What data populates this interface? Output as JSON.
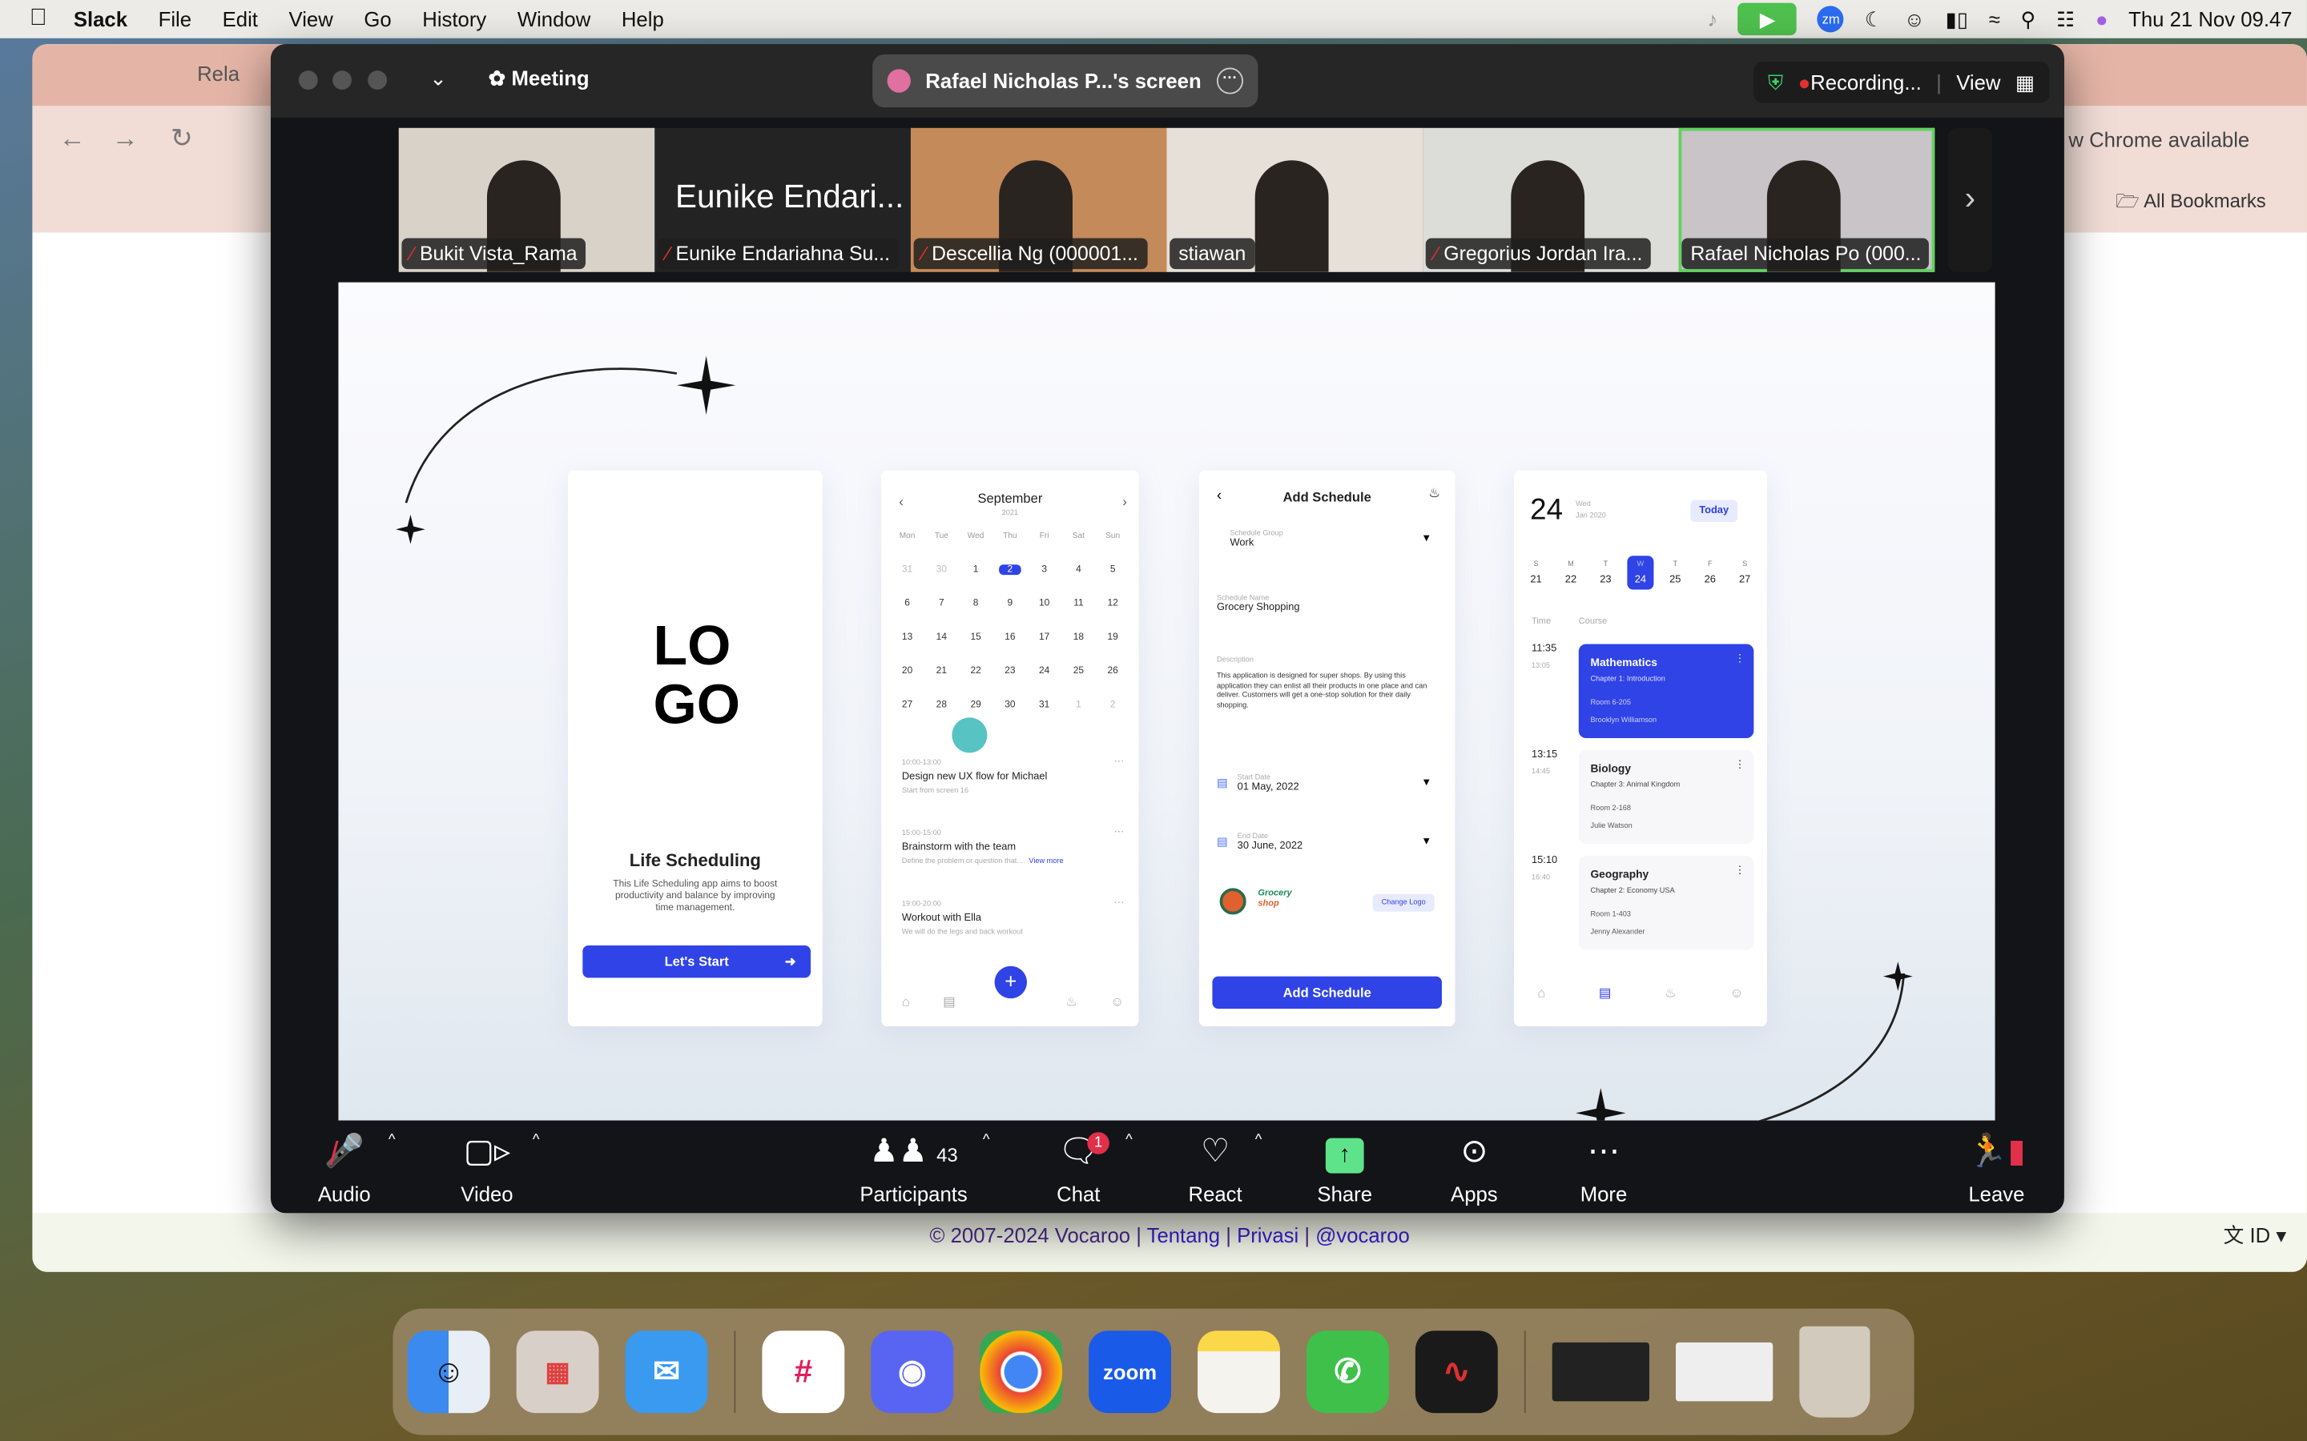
{
  "menubar": {
    "app": "Slack",
    "items": [
      "File",
      "Edit",
      "View",
      "Go",
      "History",
      "Window",
      "Help"
    ],
    "clock": "Thu 21 Nov  09.47"
  },
  "chrome": {
    "tab": "Rela",
    "bookmark_notice": "w Chrome available",
    "bookmarks": "All Bookmarks",
    "footer": {
      "copyright": "© 2007-2024 Vocaroo",
      "sep": " | ",
      "links": [
        "Tentang",
        "Privasi",
        "@vocaroo"
      ]
    },
    "lang": "ID"
  },
  "zoom": {
    "meeting_label": "Meeting",
    "share_label": "Rafael Nicholas P...'s screen",
    "recording": "Recording...",
    "view": "View",
    "participants": [
      {
        "name": "Bukit Vista_Rama",
        "muted": true,
        "bg": "#d8d2c8"
      },
      {
        "name": "Eunike Endariahna Su...",
        "muted": true,
        "bg": "#232323",
        "big": "Eunike Endari..."
      },
      {
        "name": "Descellia Ng (000001...",
        "muted": true,
        "bg": "#c58a5a"
      },
      {
        "name": "stiawan",
        "muted": false,
        "bg": "#e6e0d8"
      },
      {
        "name": "Gregorius Jordan Ira...",
        "muted": true,
        "bg": "#dcdcd8"
      },
      {
        "name": "Rafael Nicholas Po (000...",
        "muted": false,
        "bg": "#c8c4c8",
        "active": true
      }
    ],
    "toolbar": {
      "audio": "Audio",
      "video": "Video",
      "participants": "Participants",
      "participant_count": "43",
      "chat": "Chat",
      "chat_badge": "1",
      "react": "React",
      "share": "Share",
      "apps": "Apps",
      "more": "More",
      "leave": "Leave"
    }
  },
  "slide": {
    "s1": {
      "logo": [
        "LO",
        "GO"
      ],
      "title": "Life Scheduling",
      "desc": "This Life Scheduling app aims to boost productivity and balance by improving time management.",
      "button": "Let's Start"
    },
    "s2": {
      "month": "September",
      "year": "2021",
      "weekdays": [
        "Mon",
        "Tue",
        "Wed",
        "Thu",
        "Fri",
        "Sat",
        "Sun"
      ],
      "days": [
        "31",
        "30",
        "1",
        "2",
        "3",
        "4",
        "5",
        "6",
        "7",
        "8",
        "9",
        "10",
        "11",
        "12",
        "13",
        "14",
        "15",
        "16",
        "17",
        "18",
        "19",
        "20",
        "21",
        "22",
        "23",
        "24",
        "25",
        "26",
        "27",
        "28",
        "29",
        "30",
        "31",
        "1",
        "2"
      ],
      "selected": "2",
      "events": [
        {
          "time": "10:00-13:00",
          "title": "Design new UX flow for Michael",
          "sub": "Start from screen 16"
        },
        {
          "time": "15:00-15:00",
          "title": "Brainstorm with the team",
          "sub": "Define the problem or question that...",
          "more": "View more"
        },
        {
          "time": "19:00-20:00",
          "title": "Workout with Ella",
          "sub": "We will do the legs and back workout"
        }
      ]
    },
    "s3": {
      "title": "Add Schedule",
      "group_label": "Schedule Group",
      "group": "Work",
      "name_label": "Schedule Name",
      "name": "Grocery Shopping",
      "desc_label": "Description",
      "desc": "This application is designed for super shops. By using this application they can enlist all their products in one place and can deliver. Customers will get a one-stop solution for their daily shopping.",
      "start_label": "Start Date",
      "start": "01 May, 2022",
      "end_label": "End Date",
      "end": "30 June, 2022",
      "logo1": "Grocery",
      "logo2": "shop",
      "change_logo": "Change Logo",
      "button": "Add Schedule"
    },
    "s4": {
      "day": "24",
      "dow": "Wed",
      "monthyear": "Jan 2020",
      "today": "Today",
      "week": [
        {
          "l": "S",
          "d": "21"
        },
        {
          "l": "M",
          "d": "22"
        },
        {
          "l": "T",
          "d": "23"
        },
        {
          "l": "W",
          "d": "24"
        },
        {
          "l": "T",
          "d": "25"
        },
        {
          "l": "F",
          "d": "26"
        },
        {
          "l": "S",
          "d": "27"
        }
      ],
      "time_h": "Time",
      "course_h": "Course",
      "courses": [
        {
          "start": "11:35",
          "end": "13:05",
          "name": "Mathematics",
          "chapter": "Chapter 1: Introduction",
          "room": "Room 6-205",
          "teacher": "Brooklyn Williamson"
        },
        {
          "start": "13:15",
          "end": "14:45",
          "name": "Biology",
          "chapter": "Chapter 3: Animal Kingdom",
          "room": "Room 2-168",
          "teacher": "Julie Watson"
        },
        {
          "start": "15:10",
          "end": "16:40",
          "name": "Geography",
          "chapter": "Chapter 2: Economy USA",
          "room": "Room 1-403",
          "teacher": "Jenny Alexander"
        }
      ]
    }
  },
  "dock": {
    "apps": [
      "Finder",
      "Launchpad",
      "Mail",
      "Slack",
      "Discord",
      "Chrome",
      "zoom",
      "Notes",
      "WhatsApp",
      "Voice Memos"
    ],
    "zoom_label": "zoom"
  },
  "colors": {
    "accent": "#2f43e6",
    "zoom_bg": "#131417",
    "share_green": "#5fe38a",
    "leave_red": "#e0304a"
  }
}
